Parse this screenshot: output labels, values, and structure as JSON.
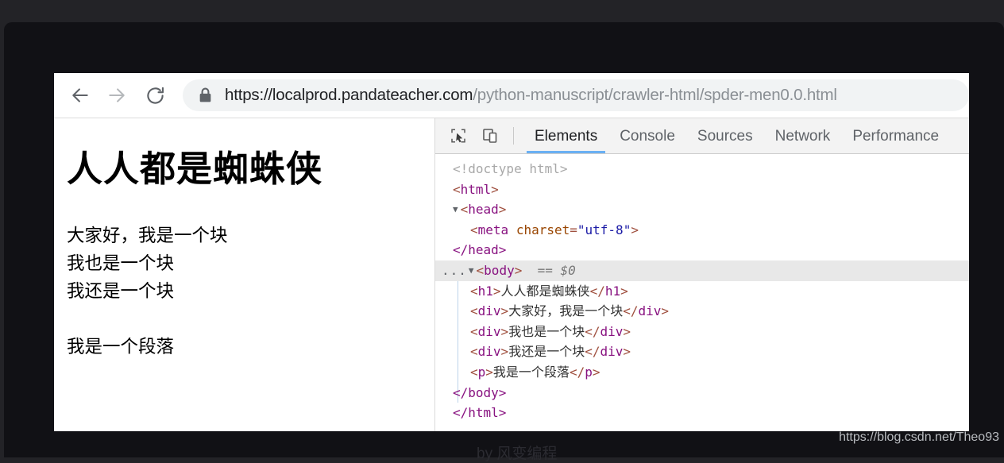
{
  "browser": {
    "nav": {
      "back_label": "Back",
      "forward_label": "Forward",
      "reload_label": "Reload"
    },
    "omnibox": {
      "security_icon": "lock-icon",
      "url_full": "https://localprod.pandateacher.com/python-manuscript/crawler-html/spder-men0.0.html",
      "url_host": "https://localprod.pandateacher.com",
      "url_path": "/python-manuscript/crawler-html/spder-men0.0.html"
    }
  },
  "page": {
    "h1": "人人都是蜘蛛侠",
    "divs": [
      "大家好，我是一个块",
      "我也是一个块",
      "我还是一个块"
    ],
    "paragraph": "我是一个段落"
  },
  "devtools": {
    "icons": {
      "inspect": "inspect-element-icon",
      "device": "device-toolbar-icon"
    },
    "tabs": [
      {
        "label": "Elements",
        "active": true
      },
      {
        "label": "Console",
        "active": false
      },
      {
        "label": "Sources",
        "active": false
      },
      {
        "label": "Network",
        "active": false
      },
      {
        "label": "Performance",
        "active": false
      }
    ],
    "dom": {
      "doctype": "<!doctype html>",
      "html_open_lt": "<",
      "html_tag": "html",
      "html_open_gt": ">",
      "head_tag": "head",
      "meta_tag": "meta",
      "meta_attr_name": "charset",
      "meta_attr_value": "\"utf-8\"",
      "head_close": "</head>",
      "body_tag": "body",
      "body_selected_marker": "== $0",
      "dots": "...",
      "triangle": "▼",
      "h1_tag": "h1",
      "h1_text": "人人都是蜘蛛侠",
      "div1_tag": "div",
      "div1_text": "大家好，我是一个块",
      "div2_tag": "div",
      "div2_text": "我也是一个块",
      "div3_tag": "div",
      "div3_text": "我还是一个块",
      "p_tag": "p",
      "p_text": "我是一个段落",
      "body_close": "</body>",
      "html_close": "</html>"
    }
  },
  "captions": {
    "byline": "by 风变编程",
    "watermark": "https://blog.csdn.net/Theo93"
  },
  "colors": {
    "accent_tab_underline": "#6ab0f3",
    "omnibox_bg": "#f1f3f4",
    "devtools_toolbar_bg": "#f3f3f3",
    "tag_color": "#881280",
    "bracket_color": "#a0503f",
    "attr_name_color": "#994500",
    "attr_value_color": "#1a1aa6",
    "stage_bg": "#232327",
    "panel_bg": "#111115"
  }
}
